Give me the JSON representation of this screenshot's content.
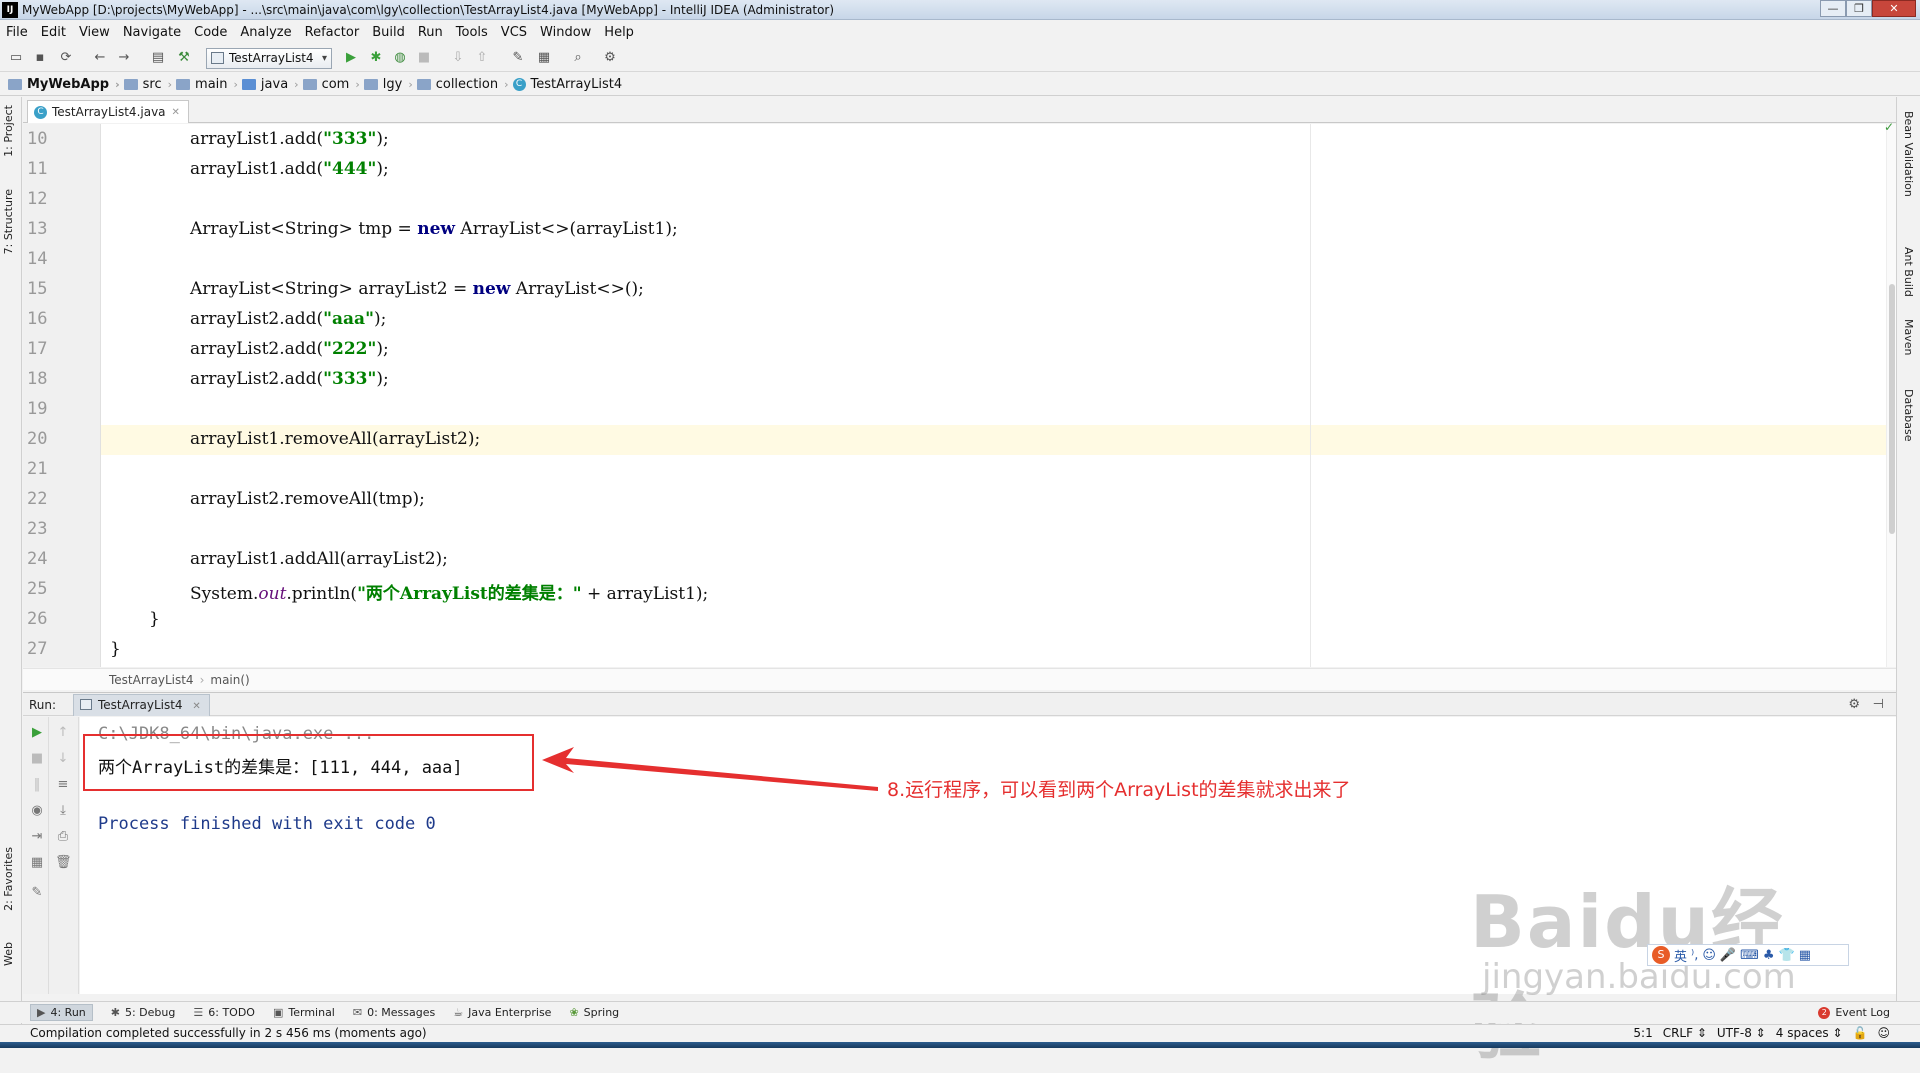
{
  "window": {
    "app_icon": "IJ",
    "title": "MyWebApp [D:\\projects\\MyWebApp] - ...\\src\\main\\java\\com\\lgy\\collection\\TestArrayList4.java [MyWebApp] - IntelliJ IDEA (Administrator)",
    "minimize": "—",
    "maximize": "❐",
    "close": "✕"
  },
  "menu": [
    "File",
    "Edit",
    "View",
    "Navigate",
    "Code",
    "Analyze",
    "Refactor",
    "Build",
    "Run",
    "Tools",
    "VCS",
    "Window",
    "Help"
  ],
  "toolbar": {
    "run_config": "TestArrayList4"
  },
  "breadcrumb": [
    "MyWebApp",
    "src",
    "main",
    "java",
    "com",
    "lgy",
    "collection",
    "TestArrayList4"
  ],
  "left_tabs": {
    "project": "1: Project",
    "structure": "7: Structure",
    "favorites": "2: Favorites",
    "web": "Web"
  },
  "right_tabs": {
    "bean": "Bean Validation",
    "ant": "Ant Build",
    "maven": "Maven",
    "database": "Database"
  },
  "editor": {
    "tab_label": "TestArrayList4.java",
    "line_numbers": [
      "10",
      "11",
      "12",
      "13",
      "14",
      "15",
      "16",
      "17",
      "18",
      "19",
      "20",
      "21",
      "22",
      "23",
      "24",
      "25",
      "26",
      "27"
    ],
    "code": {
      "l10": "arrayList1.add(",
      "l10s": "\"333\"",
      "l11": "arrayList1.add(",
      "l11s": "\"444\"",
      "l13a": "ArrayList<String> tmp = ",
      "l13kw": "new",
      "l13b": " ArrayList<>(arrayList1);",
      "l15a": "ArrayList<String> arrayList2 = ",
      "l15kw": "new",
      "l15b": " ArrayList<>();",
      "l16": "arrayList2.add(",
      "l16s": "\"aaa\"",
      "l17": "arrayList2.add(",
      "l17s": "\"222\"",
      "l18": "arrayList2.add(",
      "l18s": "\"333\"",
      "close_paren": ");",
      "l20": "arrayList1.removeAll(arrayList2);",
      "l22": "arrayList2.removeAll(tmp);",
      "l24": "arrayList1.addAll(arrayList2);",
      "l25a": "System.",
      "l25f": "out",
      "l25b": ".println(",
      "l25s": "\"两个ArrayList的差集是：\"",
      "l25c": " + arrayList1);",
      "l26": "}",
      "l27": "}"
    },
    "crumb_class": "TestArrayList4",
    "crumb_method": "main()"
  },
  "run": {
    "label": "Run:",
    "tab": "TestArrayList4",
    "cmd_line": "C:\\JDK8_64\\bin\\java.exe ...",
    "output_line": "两个ArrayList的差集是：[111, 444, aaa]",
    "exit_line": "Process finished with exit code 0"
  },
  "annotation": {
    "text": "8.运行程序，可以看到两个ArrayList的差集就求出来了",
    "color": "#e52f2f"
  },
  "watermark": {
    "logo": "Baidu经验",
    "url": "jingyan.baidu.com",
    "ime_label": "英"
  },
  "bottom_tools": [
    {
      "icon": "▶",
      "label": "4: Run"
    },
    {
      "icon": "✱",
      "label": "5: Debug"
    },
    {
      "icon": "☰",
      "label": "6: TODO"
    },
    {
      "icon": "▣",
      "label": "Terminal"
    },
    {
      "icon": "✉",
      "label": "0: Messages"
    },
    {
      "icon": "☕",
      "label": "Java Enterprise"
    },
    {
      "icon": "❀",
      "label": "Spring"
    }
  ],
  "event_log": {
    "badge": "2",
    "label": "Event Log"
  },
  "status": {
    "message": "Compilation completed successfully in 2 s 456 ms (moments ago)",
    "position": "5:1",
    "line_sep": "CRLF ⇕",
    "encoding": "UTF-8 ⇕",
    "indent": "4 spaces ⇕"
  }
}
